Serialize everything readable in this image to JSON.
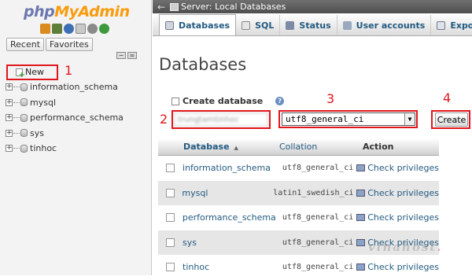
{
  "logo": {
    "php": "php",
    "my": "My",
    "admin": "Admin"
  },
  "nav": {
    "quick_icons": [
      "home-icon",
      "logout-icon",
      "help-icon",
      "docs-icon",
      "settings-icon",
      "reload-icon"
    ],
    "recent_label": "Recent",
    "favorites_label": "Favorites",
    "new_label": "New",
    "databases": [
      "information_schema",
      "mysql",
      "performance_schema",
      "sys",
      "tinhoc"
    ]
  },
  "topbar": {
    "back": "←",
    "server_label": "Server: Local Databases"
  },
  "tabs": [
    {
      "label": "Databases",
      "icon": "databases-icon"
    },
    {
      "label": "SQL",
      "icon": "sql-icon"
    },
    {
      "label": "Status",
      "icon": "status-icon"
    },
    {
      "label": "User accounts",
      "icon": "users-icon"
    },
    {
      "label": "Export",
      "icon": "export-icon"
    }
  ],
  "page": {
    "title": "Databases",
    "create_label": "Create database",
    "dbname_value": "trungtamtinhoc",
    "collation_value": "utf8_general_ci",
    "create_button": "Create"
  },
  "table": {
    "headers": {
      "database": "Database",
      "collation": "Collation",
      "action": "Action"
    },
    "rows": [
      {
        "name": "information_schema",
        "collation": "utf8_general_ci",
        "action": "Check privileges"
      },
      {
        "name": "mysql",
        "collation": "latin1_swedish_ci",
        "action": "Check privileges"
      },
      {
        "name": "performance_schema",
        "collation": "utf8_general_ci",
        "action": "Check privileges"
      },
      {
        "name": "sys",
        "collation": "utf8_general_ci",
        "action": "Check privileges"
      },
      {
        "name": "tinhoc",
        "collation": "utf8_general_ci",
        "action": "Check privileges"
      }
    ]
  },
  "annotations": [
    "1",
    "2",
    "3",
    "4"
  ],
  "watermark": {
    "text": "vinahost",
    "accent": "."
  },
  "colors": {
    "link": "#235a81",
    "annotation_red": "#e0161d",
    "topbar": "#5e5e5e"
  }
}
